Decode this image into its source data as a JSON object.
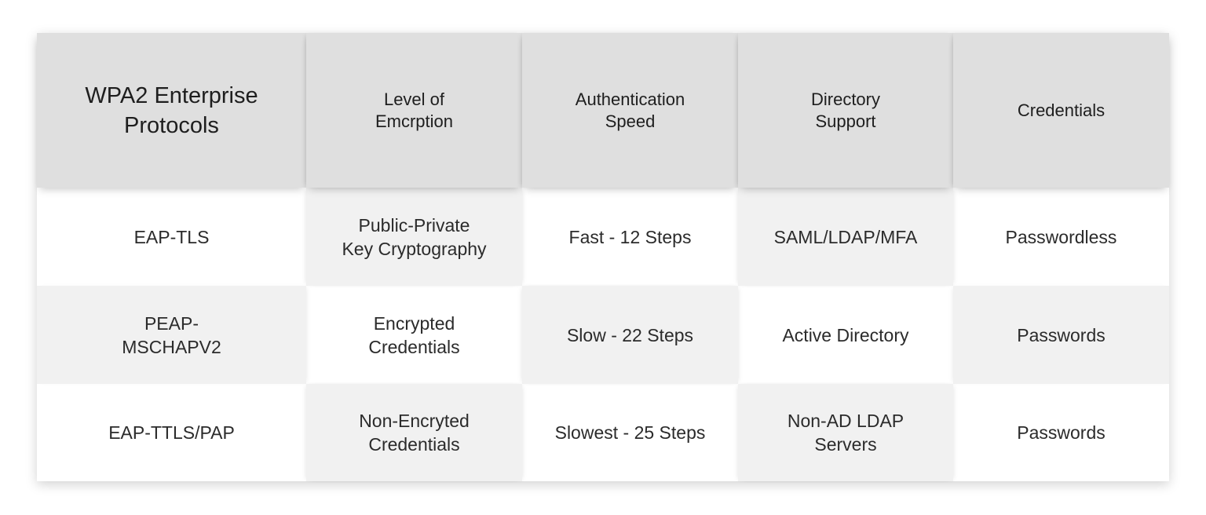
{
  "table": {
    "headers": [
      "WPA2 Enterprise\nProtocols",
      "Level of\nEmcrption",
      "Authentication\nSpeed",
      "Directory\nSupport",
      "Credentials"
    ],
    "rows": [
      [
        "EAP-TLS",
        "Public-Private\nKey Cryptography",
        "Fast - 12 Steps",
        "SAML/LDAP/MFA",
        "Passwordless"
      ],
      [
        "PEAP-\nMSCHAPV2",
        "Encrypted\nCredentials",
        "Slow - 22 Steps",
        "Active Directory",
        "Passwords"
      ],
      [
        "EAP-TTLS/PAP",
        "Non-Encryted\nCredentials",
        "Slowest - 25 Steps",
        "Non-AD LDAP\nServers",
        "Passwords"
      ]
    ]
  },
  "colors": {
    "header_bg": "#dfdfdf",
    "shaded_cell_bg": "#f1f1f1",
    "plain_cell_bg": "#ffffff",
    "text": "#2b2b2b"
  }
}
